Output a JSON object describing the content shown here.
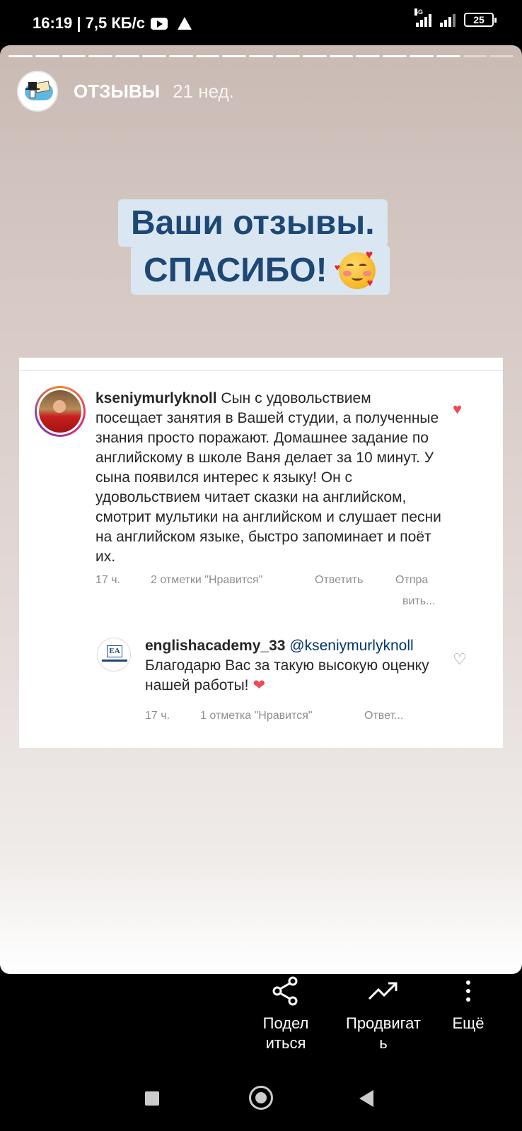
{
  "status_bar": {
    "time_speed": "16:19 | 7,5 КБ/с",
    "network": "4G",
    "battery": "25"
  },
  "story": {
    "progress_segments_total": 19,
    "progress_segments_viewed": 17,
    "account_name": "ОТЗЫВЫ",
    "posted_ago": "21 нед.",
    "headline_line1": "Ваши отзывы.",
    "headline_line2": "СПАСИБО!",
    "headline_emoji": "smiling-face-with-hearts"
  },
  "comments": [
    {
      "username": "kseniymurlyknoll",
      "text": "Сын с удовольствием посещает занятия в Вашей студии, а полученные знания просто поражают. Домашнее задание по английскому в школе Ваня делает за 10 минут. У сына появился интерес к языку! Он с удовольствием читает сказки на английском, смотрит мультики на английском и слушает песни на английском языке, быстро запоминает и поёт их.",
      "time": "17 ч.",
      "likes": "2 отметки \"Нравится\"",
      "reply": "Ответить",
      "send_line1": "Отпра",
      "send_line2": "вить..."
    },
    {
      "username": "englishacademy_33",
      "mention": "@kseniymurlyknoll",
      "text": "Благодарю Вас за такую высокую оценку нашей работы!",
      "avatar_logo": "EA",
      "time": "17 ч.",
      "likes": "1 отметка \"Нравится\"",
      "reply": "Ответ..."
    }
  ],
  "actions": {
    "share": "Подел\nиться",
    "promote": "Продвигат\nь",
    "more": "Ещё"
  },
  "colors": {
    "headline_bg": "#dae7f2",
    "headline_text": "#1d4875",
    "like_red": "#ed4956",
    "mention_blue": "#00376b"
  }
}
